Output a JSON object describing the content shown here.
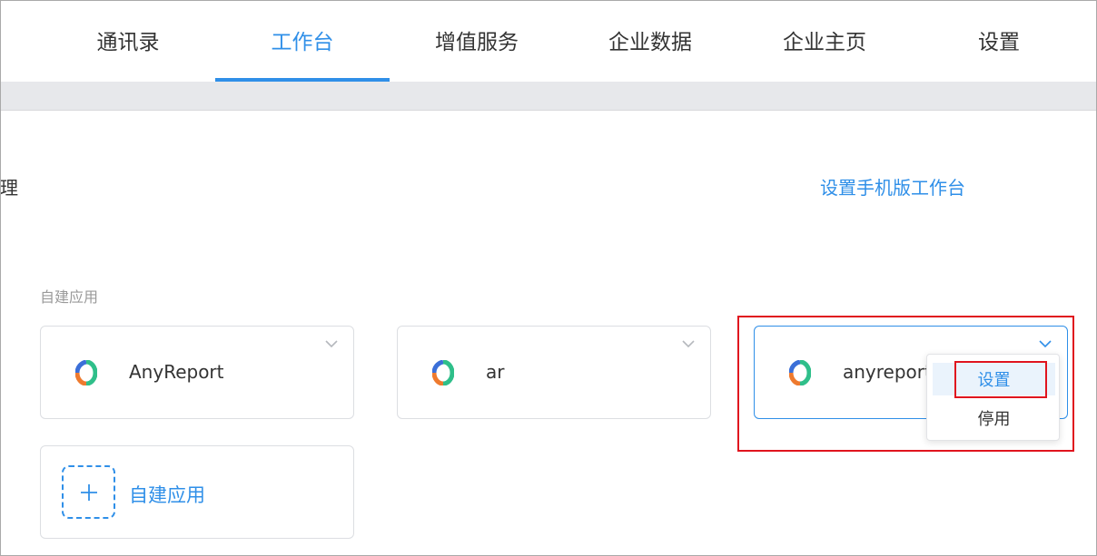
{
  "nav": {
    "tabs": [
      {
        "label": "通讯录"
      },
      {
        "label": "工作台"
      },
      {
        "label": "增值服务"
      },
      {
        "label": "企业数据"
      },
      {
        "label": "企业主页"
      },
      {
        "label": "设置"
      }
    ],
    "active_tab": "工作台"
  },
  "header": {
    "truncated_text": "理",
    "mobile_link": "设置手机版工作台"
  },
  "section": {
    "label": "自建应用"
  },
  "apps": [
    {
      "name": "AnyReport"
    },
    {
      "name": "ar"
    },
    {
      "name": "anyreport"
    }
  ],
  "add_app": {
    "label": "自建应用"
  },
  "dropdown": {
    "items": [
      {
        "label": "设置"
      },
      {
        "label": "停用"
      }
    ]
  },
  "colors": {
    "accent": "#2f8fe8",
    "annotation": "#e0141e",
    "logo_blue": "#3b6fd8",
    "logo_green": "#2fbf8a",
    "logo_orange": "#ee7a2e"
  },
  "icons": {
    "app_logo": "app-logo-icon",
    "chevron": "chevron-down-icon",
    "plus": "plus-icon"
  }
}
